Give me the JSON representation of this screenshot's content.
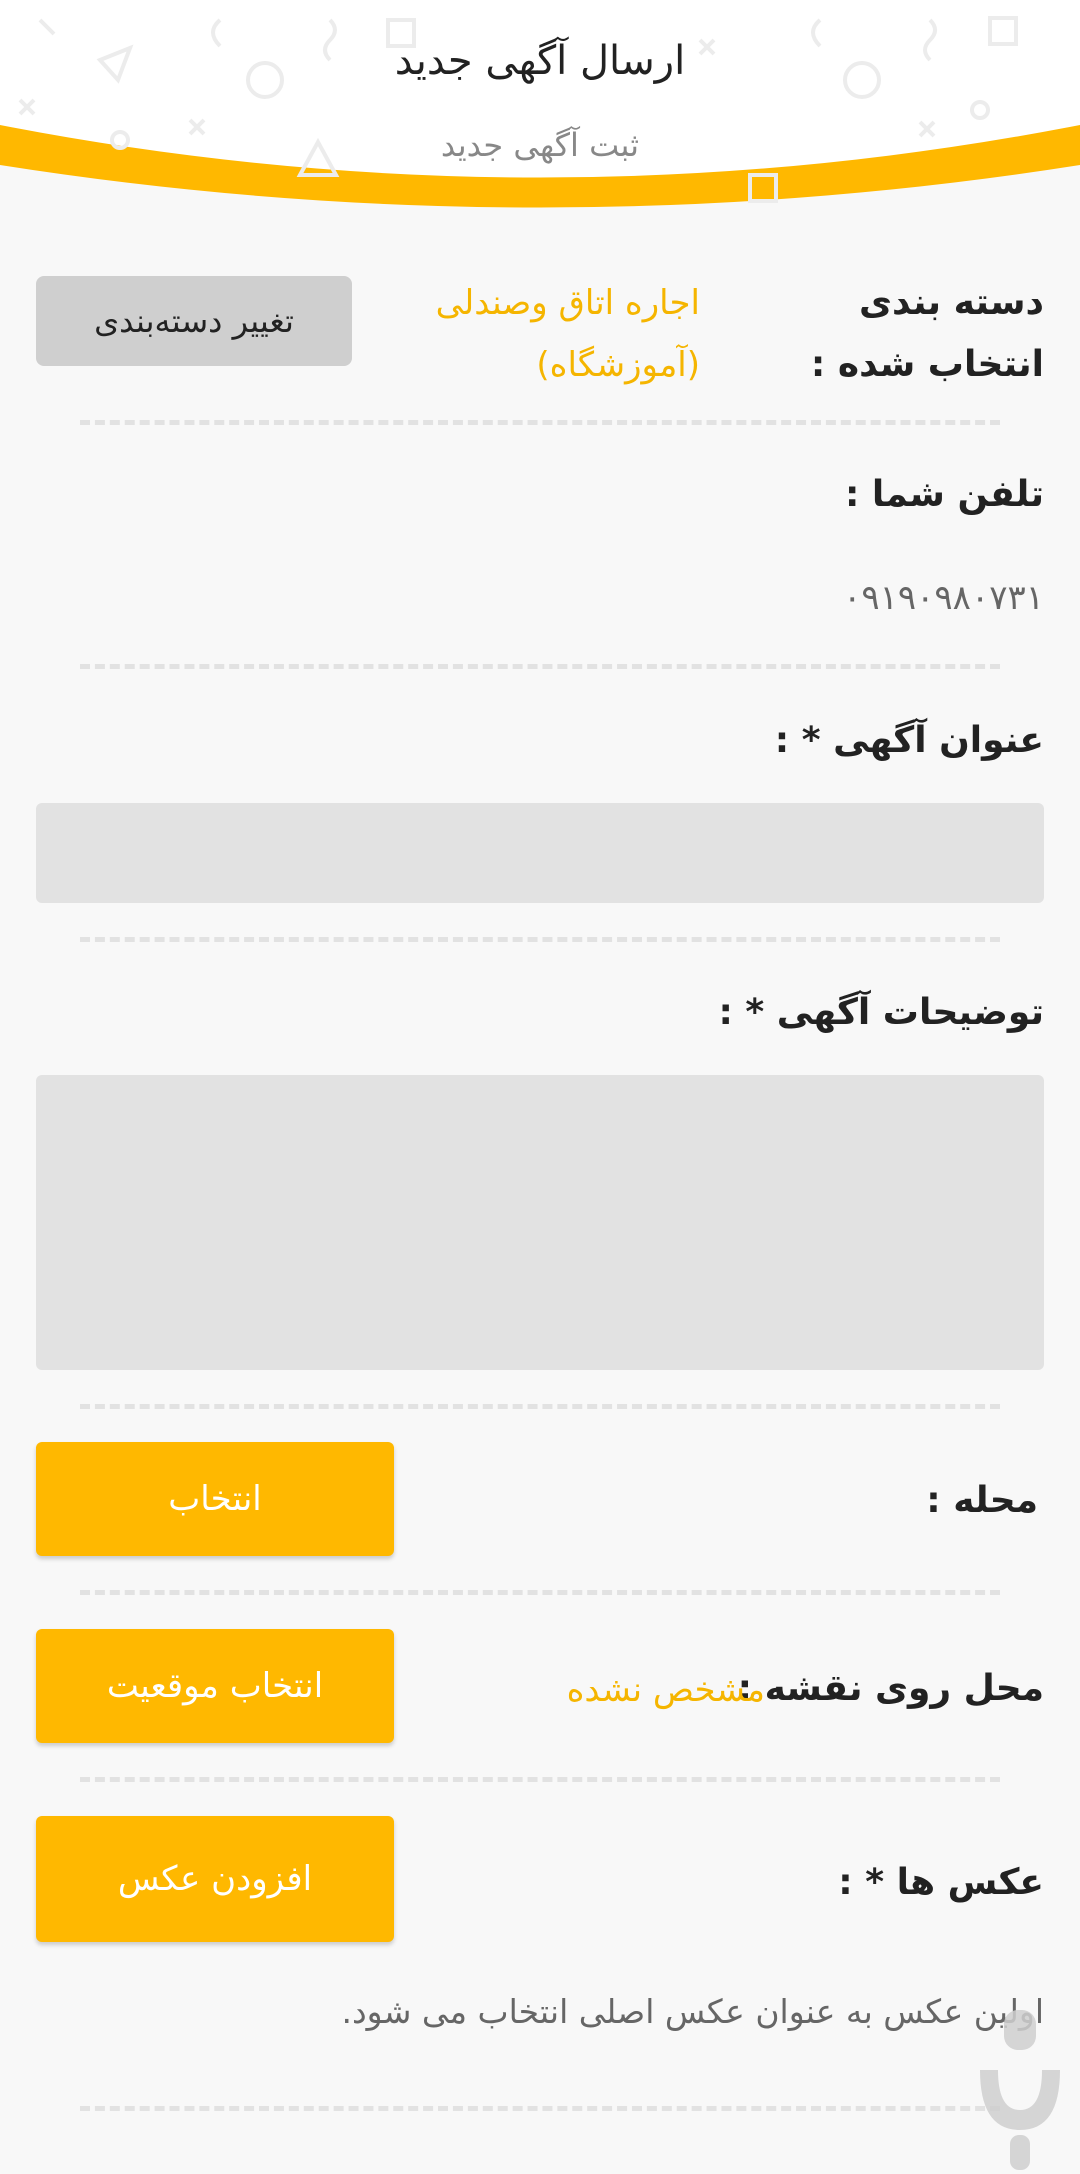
{
  "header": {
    "title": "ارسال آگهی جدید",
    "subtitle": "ثبت آگهی جدید"
  },
  "category": {
    "label": "دسته بندی انتخاب شده :",
    "value": "اجاره اتاق وصندلی (آموزشگاه)",
    "change_button": "تغییر دسته‌بندی"
  },
  "phone": {
    "label": "تلفن شما :",
    "value": "۰۹۱۹۰۹۸۰۷۳۱"
  },
  "ad_title": {
    "label": "عنوان آگهی * :",
    "value": ""
  },
  "ad_description": {
    "label": "توضیحات آگهی * :",
    "value": ""
  },
  "neighborhood": {
    "label": "محله :",
    "button": "انتخاب"
  },
  "map_location": {
    "label": "محل روی نقشه :",
    "value": "مشخص نشده",
    "button": "انتخاب موقعیت"
  },
  "photos": {
    "label": "عکس ها * :",
    "button": "افزودن عکس",
    "note": "اولین عکس به عنوان عکس اصلی انتخاب می شود."
  },
  "colors": {
    "accent": "#ffb800",
    "accent_text": "#f5b500",
    "field_bg": "#e2e2e2"
  }
}
